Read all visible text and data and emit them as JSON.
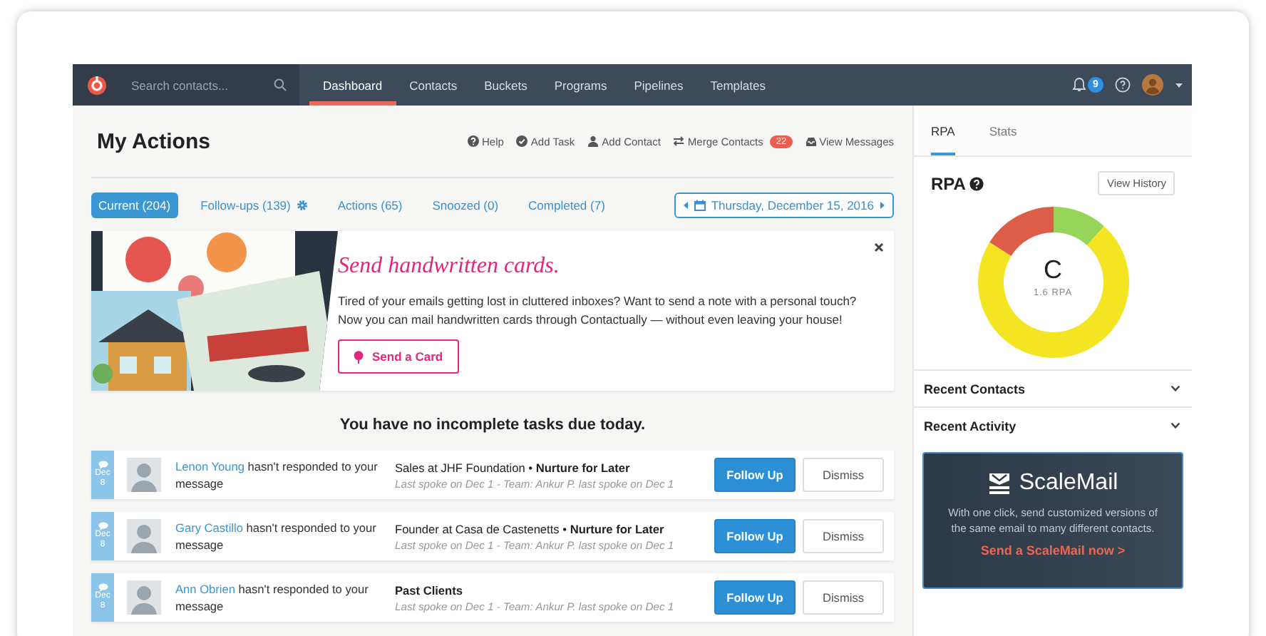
{
  "nav": {
    "search": {
      "placeholder": "Search contacts..."
    },
    "items": [
      {
        "label": "Dashboard",
        "selected": true
      },
      {
        "label": "Contacts",
        "selected": false
      },
      {
        "label": "Buckets",
        "selected": false
      },
      {
        "label": "Programs",
        "selected": false
      },
      {
        "label": "Pipelines",
        "selected": false
      },
      {
        "label": "Templates",
        "selected": false
      }
    ],
    "notifications": "9"
  },
  "page": {
    "title": "My Actions",
    "links": [
      {
        "label": "Help",
        "kind": "help"
      },
      {
        "label": "Add Task",
        "kind": "task"
      },
      {
        "label": "Add Contact",
        "kind": "contact"
      },
      {
        "label": "Merge Contacts",
        "kind": "merge",
        "badge": "22"
      },
      {
        "label": "View Messages",
        "kind": "messages"
      }
    ]
  },
  "filters": [
    {
      "label": "Current (204)",
      "selected": true
    },
    {
      "label": "Follow-ups (139)",
      "selected": false,
      "kind": "settings"
    },
    {
      "label": "Actions (65)",
      "selected": false
    },
    {
      "label": "Snoozed (0)",
      "selected": false
    },
    {
      "label": "Completed (7)",
      "selected": false
    }
  ],
  "date": "Thursday, December 15, 2016",
  "banner": {
    "kind": "picture",
    "heading": "Send handwritten cards.",
    "text": "Tired of your emails getting lost in cluttered inboxes? Want to send a note with a personal touch? Now you can mail handwritten cards through Contactually — without even leaving your house!",
    "button": "Send a Card"
  },
  "empty_message": "You have no incomplete tasks due today.",
  "tasks": [
    {
      "month": "Dec",
      "day": "8",
      "name": "Lenon Young",
      "message": "hasn't responded to your message",
      "role": "Sales at JHF Foundation •",
      "stage": "Nurture for Later",
      "detail": "Last spoke on Dec 1 - Team: Ankur P. last spoke on Dec 1",
      "actions": [
        "Follow Up",
        "Dismiss"
      ]
    },
    {
      "month": "Dec",
      "day": "8",
      "name": "Gary Castillo",
      "message": "hasn't responded to your message",
      "role": "Founder at Casa de Castenetts •",
      "stage": "Nurture for Later",
      "detail": "Last spoke on Dec 1 - Team: Ankur P. last spoke on Dec 1",
      "actions": [
        "Follow Up",
        "Dismiss"
      ]
    },
    {
      "month": "Dec",
      "day": "8",
      "name": "Ann Obrien",
      "message": "hasn't responded to your message",
      "stage": "Past Clients",
      "detail": "Last spoke on Dec 1 - Team: Ankur P. last spoke on Dec 1",
      "actions": [
        "Follow Up",
        "Dismiss"
      ]
    }
  ],
  "sidebar": {
    "tabs": [
      {
        "label": "RPA",
        "selected": true
      },
      {
        "label": "Stats",
        "selected": false
      }
    ],
    "rpa": {
      "title": "RPA",
      "button": "View History",
      "grade": "C",
      "score": "1.6 RPA"
    },
    "sections": [
      {
        "title": "Recent Contacts",
        "expanded": false
      },
      {
        "title": "Recent Activity",
        "expanded": false
      }
    ],
    "promo": {
      "title": "ScaleMail",
      "text": "With one click, send customized versions of the same email to many different contacts.",
      "link": "Send a ScaleMail now >"
    }
  }
}
